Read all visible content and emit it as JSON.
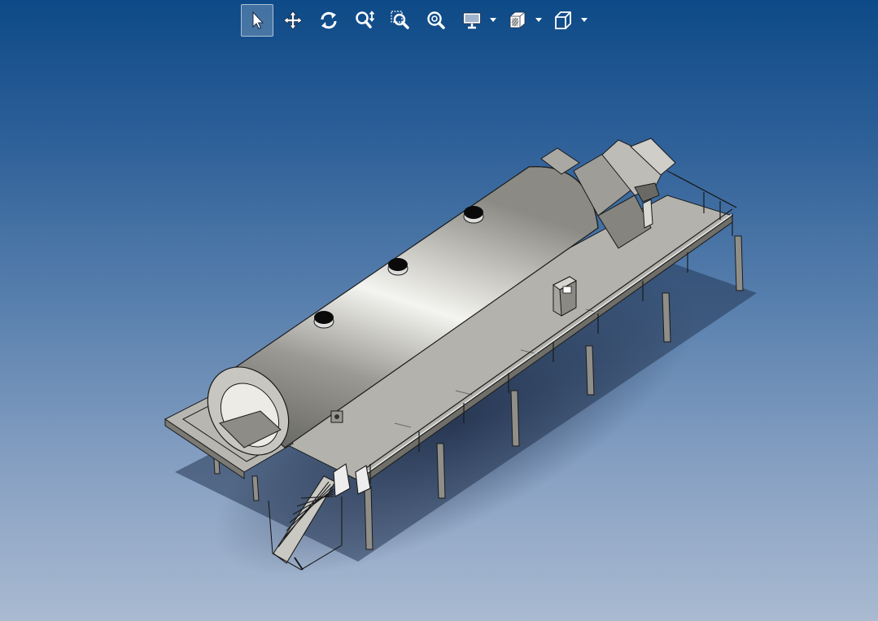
{
  "toolbar": {
    "tools": [
      {
        "name": "select-arrow-icon",
        "active": true
      },
      {
        "name": "pan-move-icon",
        "active": false
      },
      {
        "name": "rotate-icon",
        "active": false
      },
      {
        "name": "zoom-updown-icon",
        "active": false
      },
      {
        "name": "zoom-window-icon",
        "active": false
      },
      {
        "name": "zoom-fit-icon",
        "active": false
      },
      {
        "name": "display-monitor-icon",
        "active": false,
        "dropdown": true
      },
      {
        "name": "section-view-icon",
        "active": false,
        "dropdown": true
      },
      {
        "name": "view-cube-icon",
        "active": false,
        "dropdown": true
      }
    ]
  },
  "colors": {
    "background_top": "#0d4a87",
    "background_bottom": "#a9bad1",
    "model_face": "#b9b8b3",
    "model_dark": "#6f6e69",
    "model_edge": "#1a1a1a"
  }
}
